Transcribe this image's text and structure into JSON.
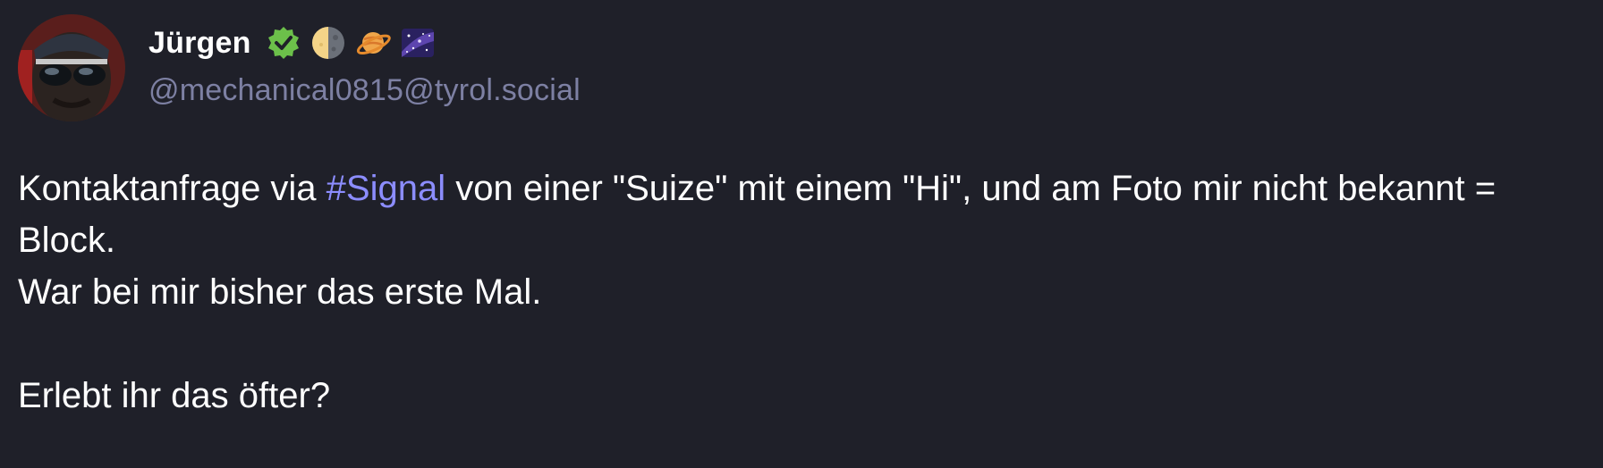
{
  "author": {
    "display_name": "Jürgen",
    "handle": "@mechanical0815@tyrol.social",
    "badges": [
      "verified-badge-icon",
      "half-moon-icon",
      "ringed-planet-icon",
      "milky-way-icon"
    ]
  },
  "post": {
    "line1_before": "Kontaktanfrage via ",
    "hashtag": "#Signal",
    "line1_after": " von einer \"Suize\" mit einem \"Hi\", und am Foto mir nicht bekannt = Block.",
    "line2": "War bei mir bisher das erste Mal.",
    "line3": "Erlebt ihr das öfter?"
  },
  "colors": {
    "background": "#1f2029",
    "text": "#ffffff",
    "handle": "#7d80a3",
    "hashtag": "#8c8dff",
    "verified": "#6cc04a"
  }
}
